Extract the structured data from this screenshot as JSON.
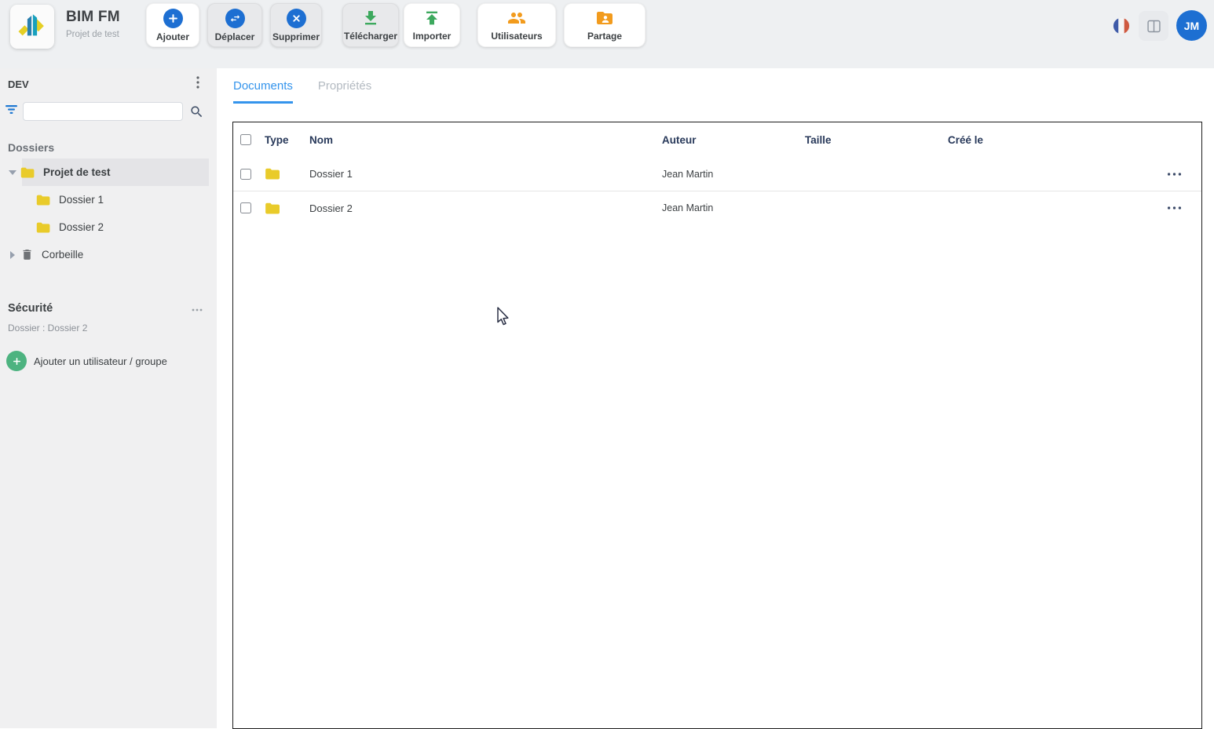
{
  "app": {
    "name": "BIM FM",
    "project": "Projet de test"
  },
  "toolbar": {
    "buttons": [
      {
        "label": "Ajouter",
        "icon": "plus-circle"
      },
      {
        "label": "Déplacer",
        "icon": "move-arrows"
      },
      {
        "label": "Supprimer",
        "icon": "close-circle"
      },
      {
        "label": "Télécharger",
        "icon": "download"
      },
      {
        "label": "Importer",
        "icon": "upload"
      },
      {
        "label": "Utilisateurs",
        "icon": "users"
      },
      {
        "label": "Partage",
        "icon": "folder-share"
      }
    ]
  },
  "header_right": {
    "language_flag": "french",
    "avatar_initials": "JM"
  },
  "sidebar": {
    "env_label": "DEV",
    "search": {
      "placeholder": "",
      "value": ""
    },
    "folders_heading": "Dossiers",
    "tree": [
      {
        "label": "Projet de test",
        "icon": "folder",
        "selected": true,
        "expanded": true
      },
      {
        "label": "Dossier 1",
        "icon": "folder"
      },
      {
        "label": "Dossier 2",
        "icon": "folder"
      },
      {
        "label": "Corbeille",
        "icon": "trash",
        "collapsed": true
      }
    ],
    "security": {
      "title": "Sécurité",
      "context": "Dossier : Dossier 2",
      "add_label": "Ajouter un utilisateur / groupe"
    }
  },
  "main": {
    "tabs": [
      {
        "label": "Documents",
        "active": true
      },
      {
        "label": "Propriétés",
        "active": false
      }
    ],
    "table": {
      "columns": [
        "Type",
        "Nom",
        "Auteur",
        "Taille",
        "Créé le"
      ],
      "rows": [
        {
          "type": "folder",
          "name": "Dossier 1",
          "author": "Jean Martin",
          "size": "",
          "created": ""
        },
        {
          "type": "folder",
          "name": "Dossier 2",
          "author": "Jean Martin",
          "size": "",
          "created": ""
        }
      ]
    }
  },
  "colors": {
    "accent_blue": "#1d6fd2",
    "tab_blue": "#3494ec",
    "folder_yellow": "#e9cb2a",
    "green": "#42a864",
    "orange": "#f29b1d",
    "header_bg": "#eef0f2",
    "sidebar_bg": "#f0f0f1",
    "table_header_text": "#28395a"
  }
}
